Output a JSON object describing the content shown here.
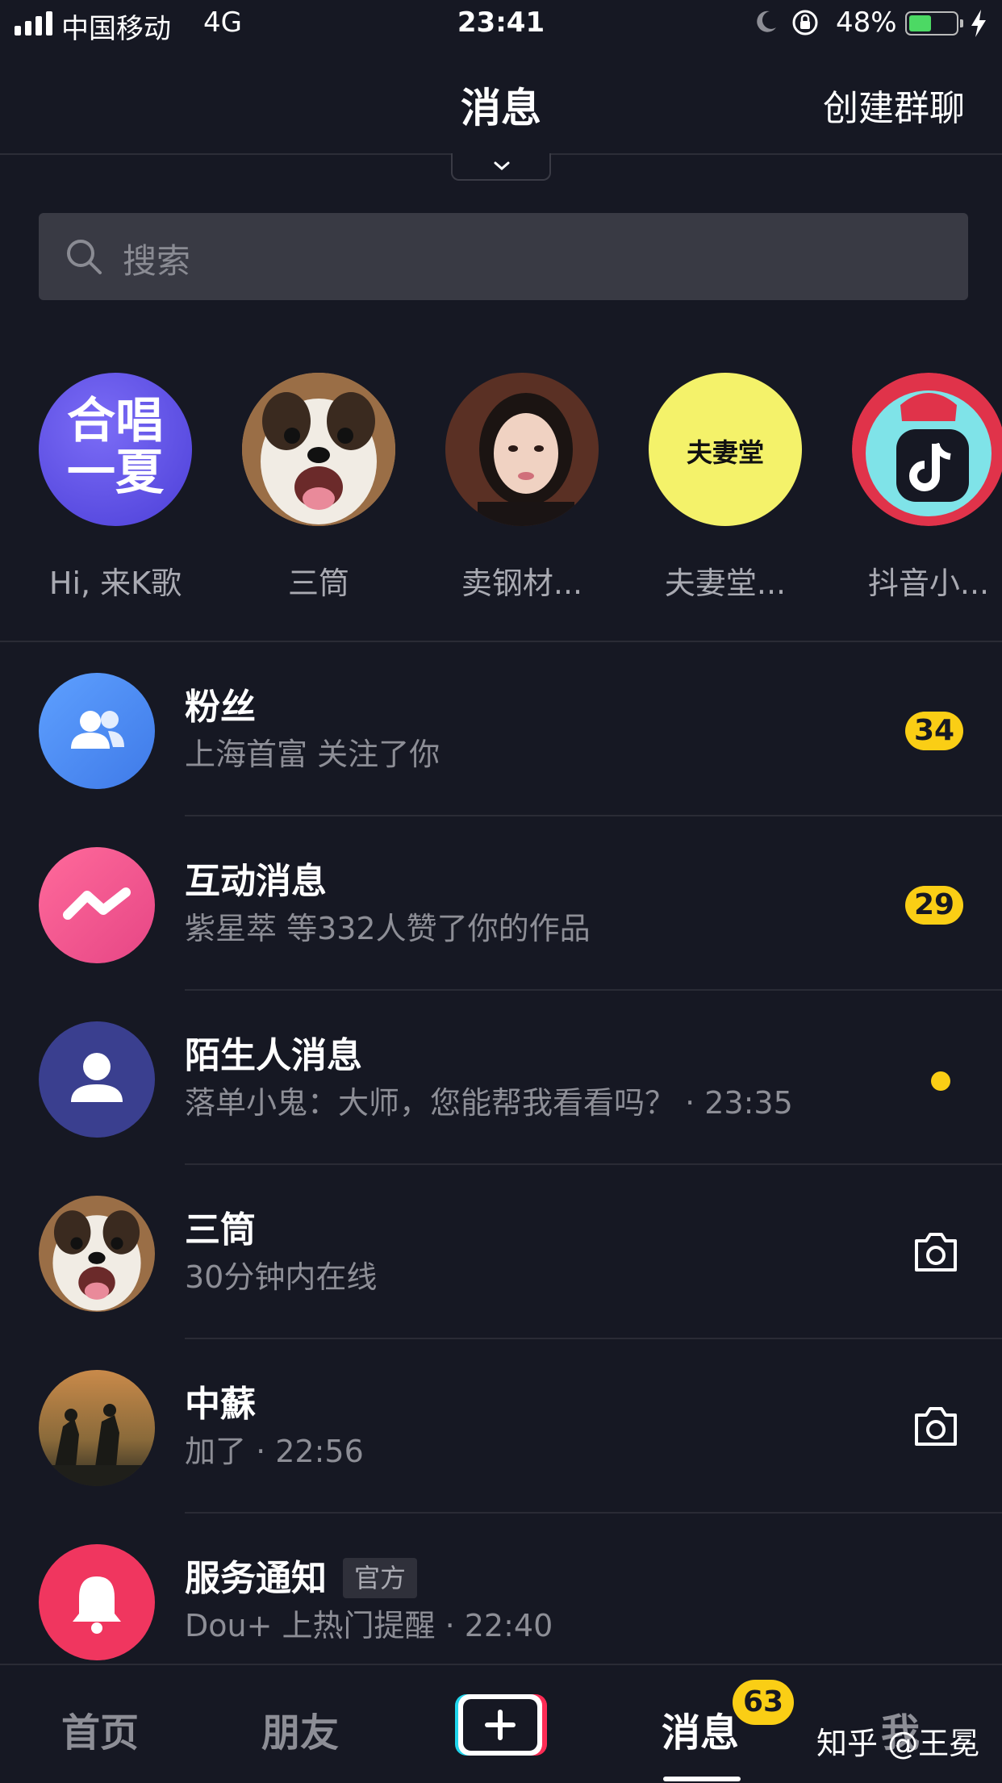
{
  "status_bar": {
    "carrier": "中国移动",
    "network": "4G",
    "time": "23:41",
    "battery_percent": "48%",
    "battery_level": 0.48
  },
  "header": {
    "title": "消息",
    "create_group": "创建群聊"
  },
  "search": {
    "placeholder": "搜索"
  },
  "stories": [
    {
      "label": "Hi, 来K歌",
      "avatar_text": [
        "合唱",
        "一夏"
      ]
    },
    {
      "label": "三筒"
    },
    {
      "label": "卖钢材..."
    },
    {
      "label": "夫妻堂...",
      "avatar_text": "夫妻堂"
    },
    {
      "label": "抖音小..."
    }
  ],
  "messages": [
    {
      "title": "粉丝",
      "subtitle": "上海首富 关注了你",
      "badge": "34",
      "icon": "fans-icon",
      "color": "#4d8ef7"
    },
    {
      "title": "互动消息",
      "subtitle": "紫星萃 等332人赞了你的作品",
      "badge": "29",
      "icon": "interaction-icon",
      "color": "#f0508a"
    },
    {
      "title": "陌生人消息",
      "subtitle": "落单小鬼：大师，您能帮我看看吗？ · 23:35",
      "icon": "stranger-icon",
      "color": "#3a3f8f"
    },
    {
      "title": "三筒",
      "subtitle": "30分钟内在线",
      "icon": "camera-icon"
    },
    {
      "title": "中蘇",
      "subtitle": "加了 · 22:56",
      "icon": "camera-icon"
    },
    {
      "title": "服务通知",
      "tag": "官方",
      "subtitle": "Dou+ 上热门提醒 · 22:40",
      "icon": "bell-icon",
      "color": "#f0365f"
    }
  ],
  "nav": {
    "home": "首页",
    "friends": "朋友",
    "messages": "消息",
    "messages_badge": "63",
    "me": "我"
  },
  "watermark": "知乎 @王冕",
  "colors": {
    "background": "#161823",
    "accent_yellow": "#face15",
    "search_bg": "#393a44"
  }
}
